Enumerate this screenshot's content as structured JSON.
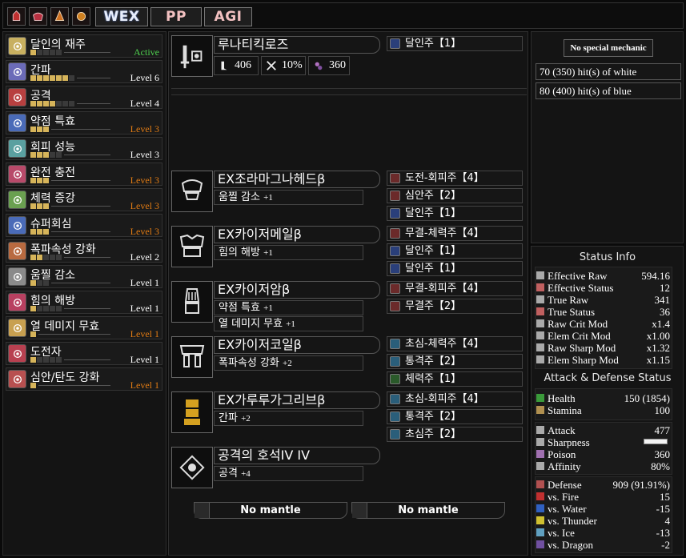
{
  "topbar": {
    "icons": [
      "mantle-red-icon",
      "mantle-red-icon",
      "mantle-orange-icon",
      "mantle-orange-icon"
    ],
    "buttons": {
      "wex": "WEX",
      "pp": "PP",
      "agi": "AGI"
    }
  },
  "skills": [
    {
      "name": "달인의 재주",
      "pips": 1,
      "max": 5,
      "level": "Active",
      "status": "active",
      "color": "#c8b060"
    },
    {
      "name": "간파",
      "pips": 6,
      "max": 7,
      "level": "Level 6",
      "status": "normal",
      "color": "#6b6bb8"
    },
    {
      "name": "공격",
      "pips": 4,
      "max": 7,
      "level": "Level 4",
      "status": "normal",
      "color": "#b84040"
    },
    {
      "name": "약점 특효",
      "pips": 3,
      "max": 3,
      "level": "Level 3",
      "status": "max",
      "color": "#4a6bb8"
    },
    {
      "name": "회피 성능",
      "pips": 3,
      "max": 5,
      "level": "Level 3",
      "status": "normal",
      "color": "#5aa0a0"
    },
    {
      "name": "완전 충전",
      "pips": 3,
      "max": 3,
      "level": "Level 3",
      "status": "max",
      "color": "#b84a6a"
    },
    {
      "name": "체력 증강",
      "pips": 3,
      "max": 3,
      "level": "Level 3",
      "status": "max",
      "color": "#6aa050"
    },
    {
      "name": "슈퍼회심",
      "pips": 3,
      "max": 3,
      "level": "Level 3",
      "status": "max",
      "color": "#4a6bb8"
    },
    {
      "name": "폭파속성 강화",
      "pips": 2,
      "max": 5,
      "level": "Level 2",
      "status": "normal",
      "color": "#b86a40"
    },
    {
      "name": "움찔 감소",
      "pips": 1,
      "max": 3,
      "level": "Level 1",
      "status": "normal",
      "color": "#8a8a8a"
    },
    {
      "name": "힘의 해방",
      "pips": 1,
      "max": 5,
      "level": "Level 1",
      "status": "normal",
      "color": "#b84060"
    },
    {
      "name": "열 데미지 무효",
      "pips": 1,
      "max": 1,
      "level": "Level 1",
      "status": "max",
      "color": "#c8a050"
    },
    {
      "name": "도전자",
      "pips": 1,
      "max": 5,
      "level": "Level 1",
      "status": "normal",
      "color": "#b84050"
    },
    {
      "name": "심안/탄도 강화",
      "pips": 1,
      "max": 1,
      "level": "Level 1",
      "status": "max",
      "color": "#b85050"
    }
  ],
  "weapon": {
    "name": "루나티킥로즈",
    "attack": "406",
    "affinity": "10%",
    "element": "360",
    "decorations": [
      {
        "name": "달인주【1】",
        "color": "blue"
      }
    ]
  },
  "armor": [
    {
      "name": "EX조라마그나헤드β",
      "skills": [
        {
          "name": "움찔 감소",
          "lv": "+1"
        }
      ],
      "decorations": [
        {
          "name": "도전-회피주【4】",
          "color": "red"
        },
        {
          "name": "심안주【2】",
          "color": "red"
        },
        {
          "name": "달인주【1】",
          "color": "blue"
        }
      ]
    },
    {
      "name": "EX카이저메일β",
      "skills": [
        {
          "name": "힘의 해방",
          "lv": "+1"
        }
      ],
      "decorations": [
        {
          "name": "무결-체력주【4】",
          "color": "red"
        },
        {
          "name": "달인주【1】",
          "color": "blue"
        },
        {
          "name": "달인주【1】",
          "color": "blue"
        }
      ]
    },
    {
      "name": "EX카이저암β",
      "skills": [
        {
          "name": "약점 특효",
          "lv": "+1"
        },
        {
          "name": "열 데미지 무효",
          "lv": "+1"
        }
      ],
      "decorations": [
        {
          "name": "무결-회피주【4】",
          "color": "red"
        },
        {
          "name": "무결주【2】",
          "color": "red"
        }
      ]
    },
    {
      "name": "EX카이저코일β",
      "skills": [
        {
          "name": "폭파속성 강화",
          "lv": "+2"
        }
      ],
      "decorations": [
        {
          "name": "초심-체력주【4】",
          "color": "cyan"
        },
        {
          "name": "통격주【2】",
          "color": "cyan"
        },
        {
          "name": "체력주【1】",
          "color": "green"
        }
      ]
    },
    {
      "name": "EX가루루가그리브β",
      "skills": [
        {
          "name": "간파",
          "lv": "+2"
        }
      ],
      "decorations": [
        {
          "name": "초심-회피주【4】",
          "color": "cyan"
        },
        {
          "name": "통격주【2】",
          "color": "cyan"
        },
        {
          "name": "초심주【2】",
          "color": "cyan"
        }
      ]
    },
    {
      "name": "공격의 호석IV IV",
      "skills": [
        {
          "name": "공격",
          "lv": "+4"
        }
      ],
      "decorations": []
    }
  ],
  "mantles": [
    "No mantle",
    "No mantle"
  ],
  "mechanic": "No special mechanic",
  "hits": [
    "70 (350) hit(s) of white",
    "80 (400) hit(s) of blue"
  ],
  "status_info": {
    "title": "Status Info",
    "rows": [
      {
        "label": "Effective Raw",
        "value": "594.16"
      },
      {
        "label": "Effective Status",
        "value": "12"
      },
      {
        "label": "True Raw",
        "value": "341"
      },
      {
        "label": "True Status",
        "value": "36"
      },
      {
        "label": "Raw Crit Mod",
        "value": "x1.4"
      },
      {
        "label": "Elem Crit Mod",
        "value": "x1.00"
      },
      {
        "label": "Raw Sharp Mod",
        "value": "x1.32"
      },
      {
        "label": "Elem Sharp Mod",
        "value": "x1.15"
      }
    ]
  },
  "attack_defense": {
    "title": "Attack & Defense Status",
    "health": {
      "label": "Health",
      "value": "150 (1854)"
    },
    "stamina": {
      "label": "Stamina",
      "value": "100"
    },
    "attack": {
      "label": "Attack",
      "value": "477"
    },
    "sharpness": {
      "label": "Sharpness"
    },
    "poison": {
      "label": "Poison",
      "value": "360"
    },
    "affinity": {
      "label": "Affinity",
      "value": "80%"
    },
    "defense": [
      {
        "label": "Defense",
        "value": "909 (91.91%)"
      },
      {
        "label": "vs. Fire",
        "value": "15"
      },
      {
        "label": "vs. Water",
        "value": "-15"
      },
      {
        "label": "vs. Thunder",
        "value": "4"
      },
      {
        "label": "vs. Ice",
        "value": "-13"
      },
      {
        "label": "vs. Dragon",
        "value": "-2"
      }
    ]
  }
}
